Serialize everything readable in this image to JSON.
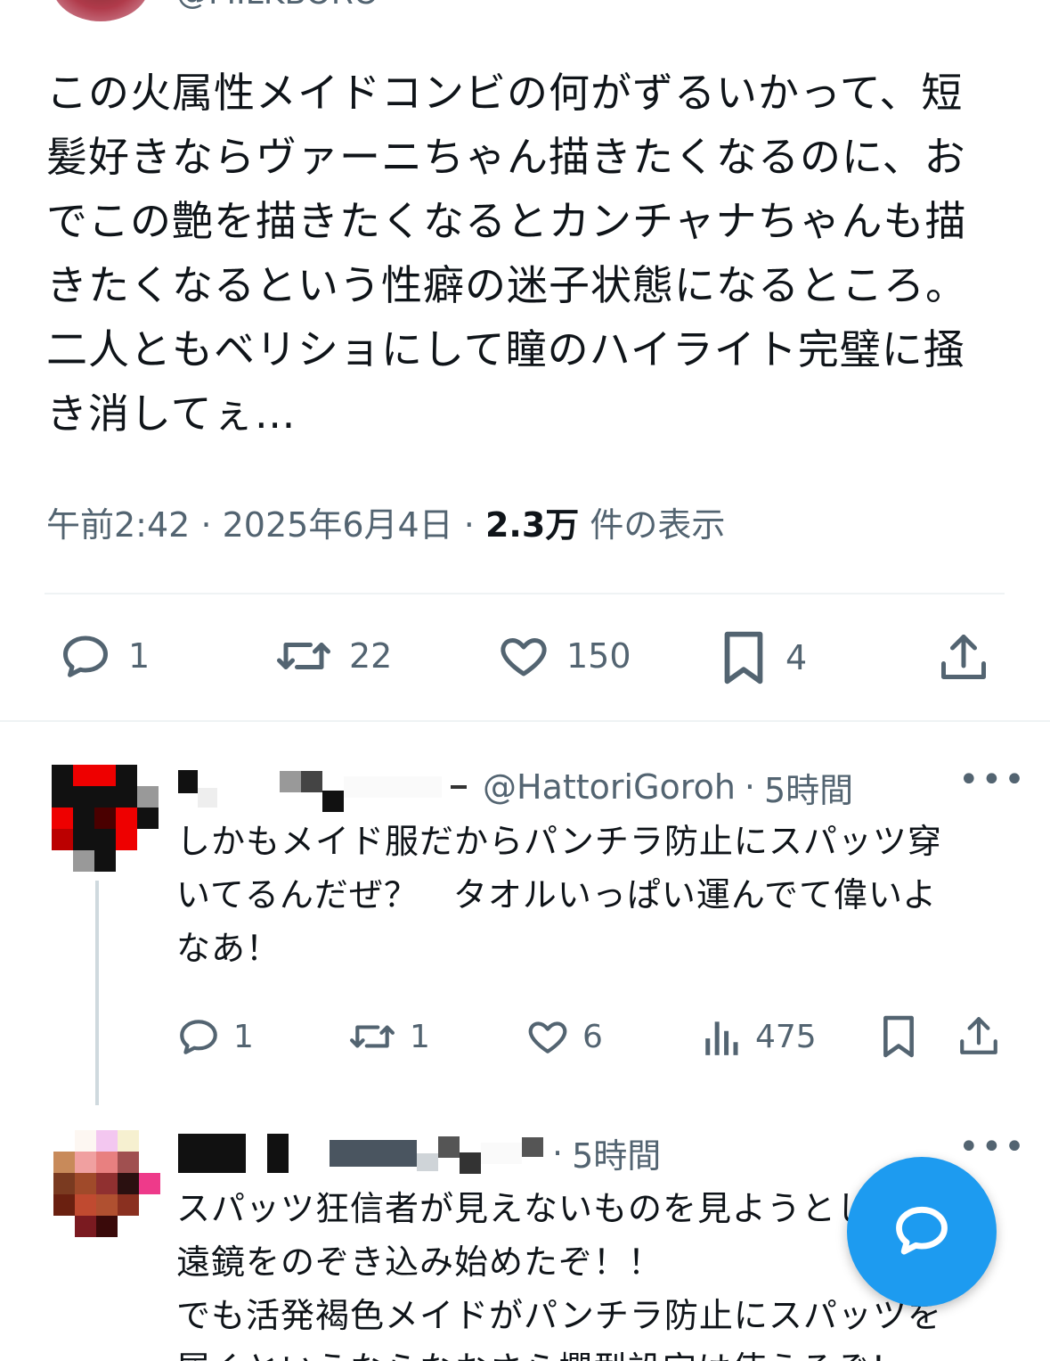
{
  "main_tweet": {
    "handle": "@MILKBORO",
    "text": "この火属性メイドコンビの何がずるいかって、短\n髪好きならヴァーニちゃん描きたくなるのに、お\nでこの艶を描きたくなるとカンチャナちゃんも描\nきたくなるという性癖の迷子状態になるところ。\n二人ともベリショにして瞳のハイライト完璧に掻\nき消してぇ…",
    "time": "午前2:42",
    "date": "2025年6月4日",
    "views_count": "2.3万",
    "views_label": "件の表示",
    "separator": "·",
    "actions": {
      "replies": "1",
      "retweets": "22",
      "likes": "150",
      "bookmarks": "4"
    }
  },
  "replies": [
    {
      "handle": "@HattoriGoroh",
      "time": "5時間",
      "text": "しかもメイド服だからパンチラ防止にスパッツ穿\nいてるんだぜ？　タオルいっぱい運んでて偉いよ\nなあ！",
      "actions": {
        "replies": "1",
        "retweets": "1",
        "likes": "6",
        "views": "475"
      }
    },
    {
      "time": "5時間",
      "text": "スパッツ狂信者が見えないものを見ようとして望\n遠鏡をのぞき込み始めたぞ！！\nでも活発褐色メイドがパンチラ防止にスパッツを\n履くというならなおさら欄型設定は使えるぞ！"
    }
  ],
  "icons": {
    "reply": "reply-icon",
    "retweet": "retweet-icon",
    "like": "heart-icon",
    "bookmark": "bookmark-icon",
    "share": "share-icon",
    "views": "views-icon",
    "more": "more-icon",
    "compose": "compose-reply-icon"
  },
  "colors": {
    "accent": "#1d9bf0",
    "secondary_text": "#536471",
    "primary_text": "#0f1419",
    "divider": "#eff3f4"
  }
}
